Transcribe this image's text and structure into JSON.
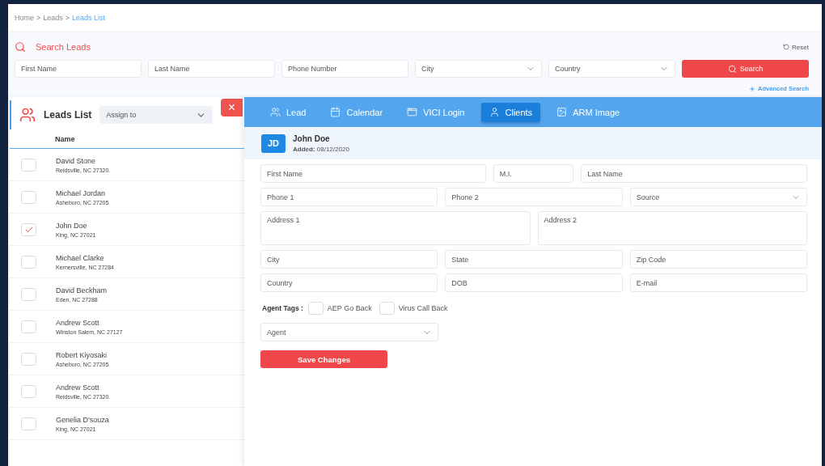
{
  "breadcrumb": [
    {
      "label": "Home",
      "current": false
    },
    {
      "label": "Leads",
      "current": false
    },
    {
      "label": "Leads List",
      "current": true
    }
  ],
  "breadcrumb_separator": ">",
  "search": {
    "title": "Search Leads",
    "reset": "Reset",
    "fields": [
      {
        "kind": "text",
        "placeholder": "First Name"
      },
      {
        "kind": "text",
        "placeholder": "Last Name"
      },
      {
        "kind": "text",
        "placeholder": "Phone Number"
      },
      {
        "kind": "select",
        "placeholder": "City"
      },
      {
        "kind": "select",
        "placeholder": "Country"
      }
    ],
    "button": "Search",
    "advanced": "Advanced Search"
  },
  "leads": {
    "title": "Leads List",
    "assign": {
      "placeholder": "Assign to"
    },
    "close": "×",
    "column": "Name",
    "rows": [
      {
        "name": "David Stone",
        "location": "Reidsville, NC 27320.",
        "checked": false
      },
      {
        "name": "Michael Jordan",
        "location": "Asheboro, NC 27205",
        "checked": false
      },
      {
        "name": "John Doe",
        "location": "King, NC 27021",
        "checked": true
      },
      {
        "name": "Michael Clarke",
        "location": "Kernersville, NC 27284",
        "checked": false
      },
      {
        "name": "David Beckham",
        "location": "Eden, NC 27288",
        "checked": false
      },
      {
        "name": "Andrew Scott",
        "location": "Winston Salem, NC 27127",
        "checked": false
      },
      {
        "name": "Robert Kiyosaki",
        "location": "Asheboro, NC 27205",
        "checked": false
      },
      {
        "name": "Andrew Scott",
        "location": "Reidsville, NC 27320.",
        "checked": false
      },
      {
        "name": "Genelia D'souza",
        "location": "King, NC 27021",
        "checked": false
      }
    ]
  },
  "drawer": {
    "tabs": [
      {
        "label": "Lead",
        "selected": false
      },
      {
        "label": "Calendar",
        "selected": false
      },
      {
        "label": "VICI Login",
        "selected": false
      },
      {
        "label": "Clients",
        "selected": true
      },
      {
        "label": "ARM Image",
        "selected": false
      }
    ],
    "client": {
      "initials": "JD",
      "name": "John Doe",
      "added_label": "Added:",
      "added": "08/12/2020"
    },
    "form_rows": [
      {
        "fields": [
          {
            "kind": "text",
            "placeholder": "First Name"
          },
          {
            "kind": "text",
            "placeholder": "M.I."
          },
          {
            "kind": "text",
            "placeholder": "Last Name"
          }
        ]
      },
      {
        "fields": [
          {
            "kind": "text",
            "placeholder": "Phone 1"
          },
          {
            "kind": "text",
            "placeholder": "Phone 2"
          },
          {
            "kind": "select",
            "placeholder": "Source"
          }
        ]
      },
      {
        "fields": [
          {
            "kind": "textarea",
            "placeholder": "Address 1"
          },
          {
            "kind": "textarea",
            "placeholder": "Address 2"
          }
        ]
      },
      {
        "fields": [
          {
            "kind": "text",
            "placeholder": "City"
          },
          {
            "kind": "text",
            "placeholder": "State"
          },
          {
            "kind": "text",
            "placeholder": "Zip Code"
          }
        ]
      },
      {
        "fields": [
          {
            "kind": "text",
            "placeholder": "Country"
          },
          {
            "kind": "text",
            "placeholder": "DOB"
          },
          {
            "kind": "text",
            "placeholder": "E-mail"
          }
        ]
      }
    ],
    "agent_tags": {
      "label": "Agent Tags :",
      "tags": [
        {
          "label": "AEP Go Back",
          "checked": false
        },
        {
          "label": "Virus Call Back",
          "checked": false
        }
      ]
    },
    "agent": {
      "placeholder": "Agent"
    },
    "save": "Save Changes"
  }
}
